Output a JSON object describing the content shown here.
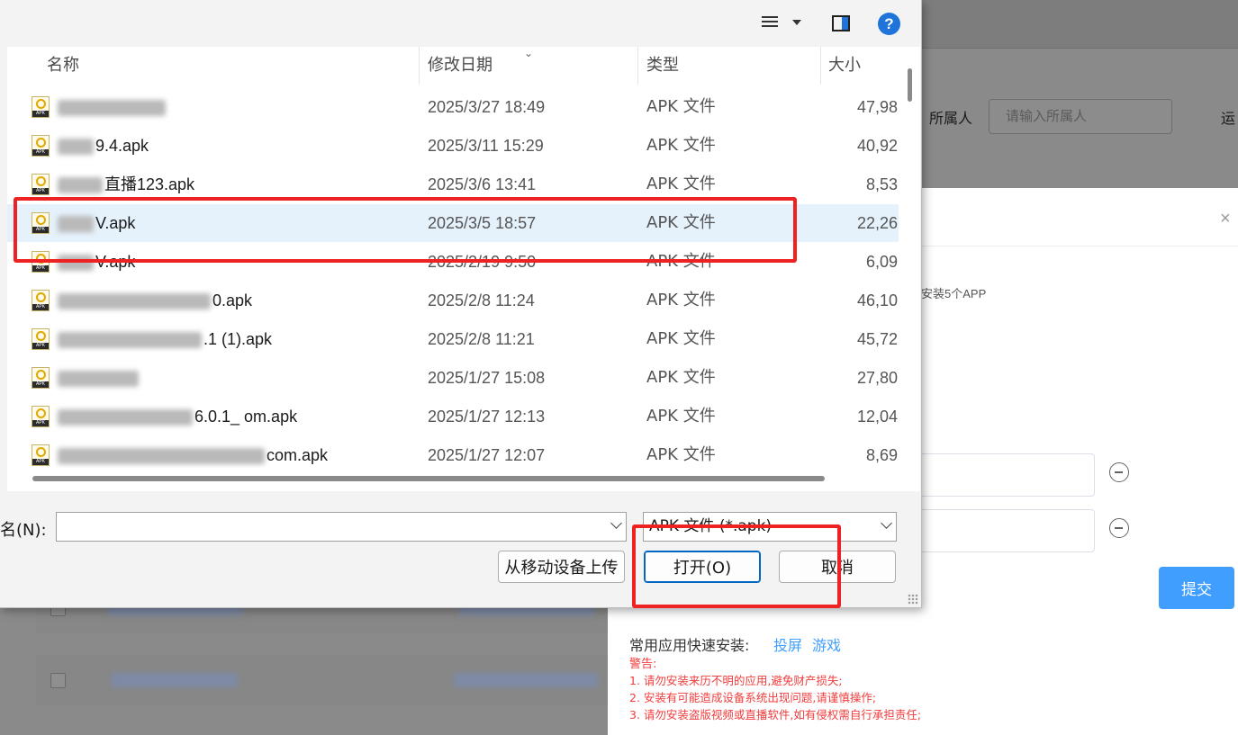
{
  "background_page": {
    "owner_label": "所属人",
    "owner_placeholder": "请输入所属人",
    "op_label_partial": "运"
  },
  "modal": {
    "close_glyph": "×",
    "hint_partial": "安装5个APP",
    "submit_label": "提交",
    "quick_install_label": "常用应用快速安装:",
    "quick_links": [
      "投屏",
      "游戏"
    ],
    "warning_title": "警告:",
    "warnings": [
      "1. 请勿安装来历不明的应用,避免财产损失;",
      "2. 安装有可能造成设备系统出现问题,请谨慎操作;",
      "3. 请勿安装盗版视频或直播软件,如有侵权需自行承担责任;"
    ]
  },
  "dialog": {
    "help_glyph": "?",
    "columns": {
      "name": "名称",
      "date": "修改日期",
      "type": "类型",
      "size": "大小"
    },
    "files": [
      {
        "name_visible": "",
        "date": "2025/3/27 18:49",
        "type": "APK 文件",
        "size": "47,98"
      },
      {
        "name_visible": "9.4.apk",
        "date": "2025/3/11 15:29",
        "type": "APK 文件",
        "size": "40,92"
      },
      {
        "name_visible": "直播123.apk",
        "date": "2025/3/6 13:41",
        "type": "APK 文件",
        "size": "8,53"
      },
      {
        "name_visible": "V.apk",
        "date": "2025/3/5 18:57",
        "type": "APK 文件",
        "size": "22,26"
      },
      {
        "name_visible": "V.apk",
        "date": "2025/2/19 9:50",
        "type": "APK 文件",
        "size": "6,09"
      },
      {
        "name_visible": "0.apk",
        "date": "2025/2/8 11:24",
        "type": "APK 文件",
        "size": "46,10"
      },
      {
        "name_visible": ".1 (1).apk",
        "date": "2025/2/8 11:21",
        "type": "APK 文件",
        "size": "45,72"
      },
      {
        "name_visible": "",
        "date": "2025/1/27 15:08",
        "type": "APK 文件",
        "size": "27,80"
      },
      {
        "name_visible": "6.0.1_ om.apk",
        "date": "2025/1/27 12:13",
        "type": "APK 文件",
        "size": "12,04"
      },
      {
        "name_visible": "com.apk",
        "date": "2025/1/27 12:07",
        "type": "APK 文件",
        "size": "8,69"
      }
    ],
    "selected_index": 3,
    "filename_label": "名(N):",
    "filename_value": "",
    "filetype_value": "APK 文件 (*.apk)",
    "upload_button": "从移动设备上传",
    "open_button": "打开(O)",
    "cancel_button": "取消"
  },
  "annotation_color": "#ee2222"
}
